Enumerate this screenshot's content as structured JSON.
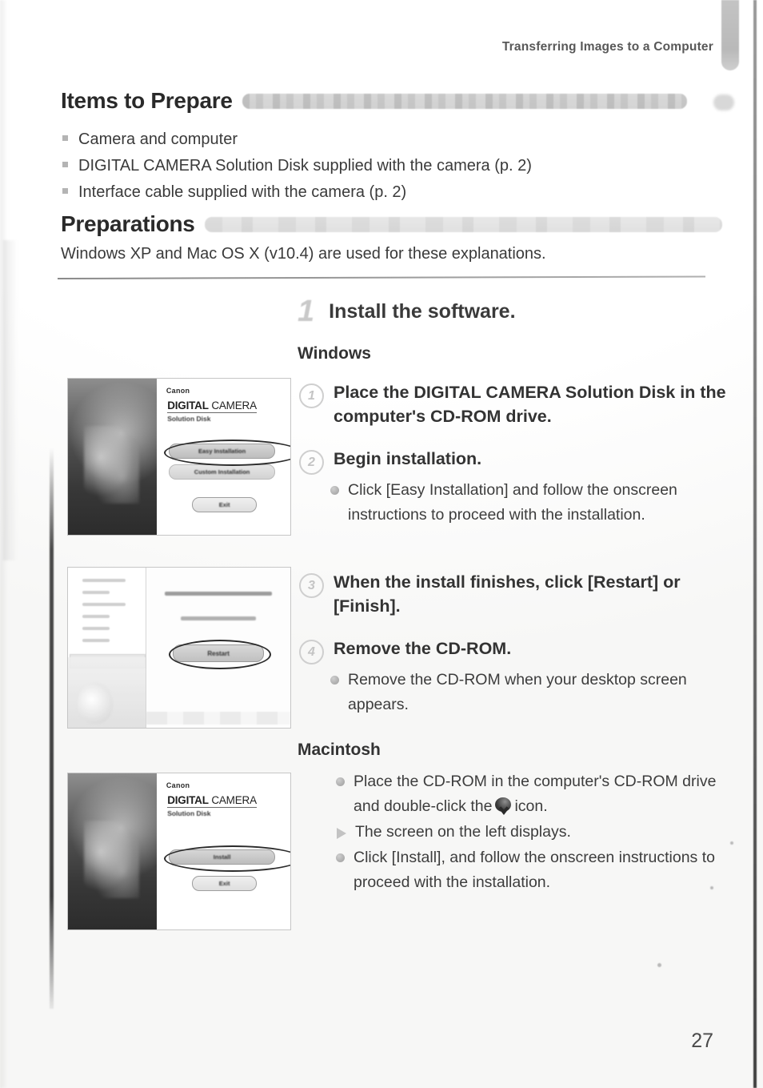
{
  "header": {
    "running_title": "Transferring Images to a Computer"
  },
  "sections": {
    "items": {
      "title": "Items to Prepare",
      "bullets": [
        "Camera and computer",
        "DIGITAL CAMERA Solution Disk supplied with the camera (p. 2)",
        "Interface cable supplied with the camera (p. 2)"
      ]
    },
    "preparations": {
      "title": "Preparations",
      "note": "Windows XP and Mac OS X (v10.4) are used for these explanations."
    }
  },
  "step": {
    "number": "1",
    "title": "Install the software."
  },
  "windows": {
    "heading": "Windows",
    "steps": [
      {
        "marker": "1",
        "title": "Place the DIGITAL CAMERA Solution Disk in the computer's CD-ROM drive.",
        "bullets": []
      },
      {
        "marker": "2",
        "title": "Begin installation.",
        "bullets": [
          "Click [Easy Installation] and follow the onscreen instructions to proceed with the installation."
        ]
      },
      {
        "marker": "3",
        "title": "When the install finishes, click [Restart] or [Finish].",
        "bullets": []
      },
      {
        "marker": "4",
        "title": "Remove the CD-ROM.",
        "bullets": [
          "Remove the CD-ROM when your desktop screen appears."
        ]
      }
    ]
  },
  "macintosh": {
    "heading": "Macintosh",
    "bullets": [
      {
        "type": "dot",
        "text_before": "Place the CD-ROM in the computer's CD-ROM drive and double-click the",
        "text_after": "icon."
      },
      {
        "type": "triangle",
        "text": "The screen on the left displays."
      },
      {
        "type": "dot",
        "text": "Click [Install], and follow the onscreen instructions to proceed with the installation."
      }
    ]
  },
  "thumbnails": {
    "installer_win": {
      "brand": "Canon",
      "title_bold": "DIGITAL",
      "title_light": " CAMERA",
      "subtitle": "Solution Disk",
      "buttons": [
        "Easy Installation",
        "Custom Installation",
        "Exit"
      ],
      "highlighted_button": "Easy Installation"
    },
    "finish_dialog": {
      "message": "Installation of the software has been completed",
      "sub_message": "Please leave onscreen instructions",
      "button": "Restart",
      "highlighted_button": "Restart"
    },
    "installer_mac": {
      "brand": "Canon",
      "title_bold": "DIGITAL",
      "title_light": " CAMERA",
      "subtitle": "Solution Disk",
      "buttons": [
        "Install",
        "Exit"
      ],
      "highlighted_button": "Install"
    }
  },
  "footer": {
    "page_number": "27"
  },
  "colors": {
    "text": "#333333",
    "muted": "#b4b4b4",
    "rule": "#8a8a8a"
  }
}
